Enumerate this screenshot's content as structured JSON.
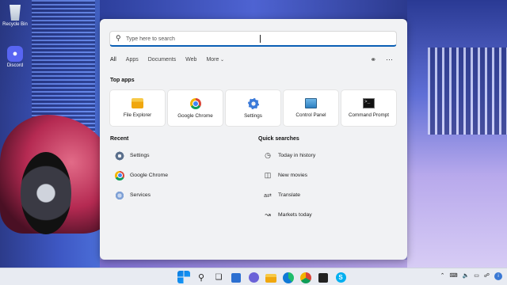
{
  "desktop": {
    "icons": [
      {
        "label": "Recycle Bin"
      },
      {
        "label": "Discord"
      }
    ]
  },
  "start_menu": {
    "search": {
      "placeholder": "Type here to search"
    },
    "filters": [
      "All",
      "Apps",
      "Documents",
      "Web",
      "More"
    ],
    "top_apps_title": "Top apps",
    "top_apps": [
      {
        "label": "File Explorer",
        "icon": "folder-icon"
      },
      {
        "label": "Google Chrome",
        "icon": "chrome-icon"
      },
      {
        "label": "Settings",
        "icon": "gear-icon"
      },
      {
        "label": "Control Panel",
        "icon": "control-panel-icon"
      },
      {
        "label": "Command Prompt",
        "icon": "terminal-icon"
      }
    ],
    "recent_title": "Recent",
    "recent": [
      {
        "label": "Settings",
        "icon": "gear-icon"
      },
      {
        "label": "Google Chrome",
        "icon": "chrome-icon"
      },
      {
        "label": "Services",
        "icon": "services-icon"
      }
    ],
    "quick_title": "Quick searches",
    "quick": [
      {
        "label": "Today in history",
        "icon": "clock-icon"
      },
      {
        "label": "New movies",
        "icon": "movie-icon"
      },
      {
        "label": "Translate",
        "icon": "translate-icon"
      },
      {
        "label": "Markets today",
        "icon": "chart-icon"
      }
    ]
  },
  "colors": {
    "accent": "#0a5fb5",
    "menu_bg": "#f1f2f4",
    "taskbar_bg": "#e8ebf2"
  }
}
